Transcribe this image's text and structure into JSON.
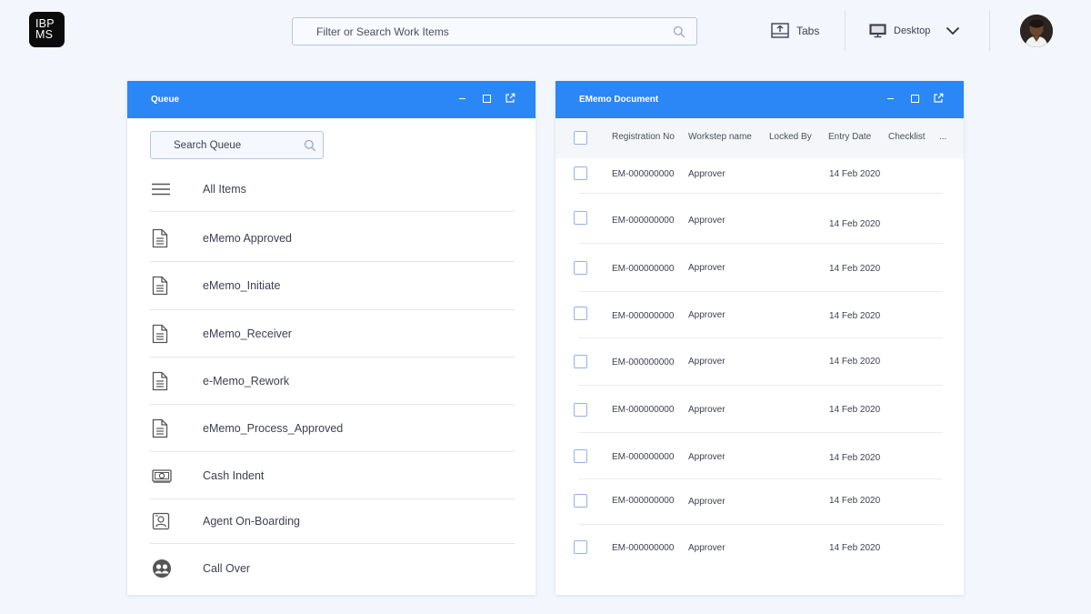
{
  "header": {
    "logo_line1": "IBP",
    "logo_line2": "MS",
    "search_placeholder": "Filter or Search Work Items",
    "tabs_label": "Tabs",
    "desktop_label": "Desktop"
  },
  "queue_panel": {
    "title": "Queue",
    "search_placeholder": "Search Queue",
    "items": [
      {
        "label": "All Items",
        "icon": "menu-icon"
      },
      {
        "label": "eMemo Approved",
        "icon": "document-icon"
      },
      {
        "label": "eMemo_Initiate",
        "icon": "document-icon"
      },
      {
        "label": "eMemo_Receiver",
        "icon": "document-icon"
      },
      {
        "label": "e-Memo_Rework",
        "icon": "document-icon"
      },
      {
        "label": "eMemo_Process_Approved",
        "icon": "document-icon"
      },
      {
        "label": "Cash Indent",
        "icon": "cash-icon"
      },
      {
        "label": "Agent On-Boarding",
        "icon": "id-card-icon"
      },
      {
        "label": "Call Over",
        "icon": "group-icon"
      }
    ]
  },
  "document_panel": {
    "title": "EMemo Document",
    "columns": [
      "Registration No",
      "Workstep name",
      "Locked By",
      "Entry Date",
      "Checklist",
      "..."
    ],
    "rows": [
      {
        "reg_no": "EM-000000000",
        "workstep": "Approver",
        "locked_by": "",
        "entry_date": "14 Feb 2020"
      },
      {
        "reg_no": "EM-000000000",
        "workstep": "Approver",
        "locked_by": "",
        "entry_date": "14 Feb 2020"
      },
      {
        "reg_no": "EM-000000000",
        "workstep": "Approver",
        "locked_by": "",
        "entry_date": "14 Feb 2020"
      },
      {
        "reg_no": "EM-000000000",
        "workstep": "Approver",
        "locked_by": "",
        "entry_date": "14 Feb 2020"
      },
      {
        "reg_no": "EM-000000000",
        "workstep": "Approver",
        "locked_by": "",
        "entry_date": "14 Feb 2020"
      },
      {
        "reg_no": "EM-000000000",
        "workstep": "Approver",
        "locked_by": "",
        "entry_date": "14 Feb 2020"
      },
      {
        "reg_no": "EM-000000000",
        "workstep": "Approver",
        "locked_by": "",
        "entry_date": "14 Feb 2020"
      },
      {
        "reg_no": "EM-000000000",
        "workstep": "Approver",
        "locked_by": "",
        "entry_date": "14 Feb 2020"
      },
      {
        "reg_no": "EM-000000000",
        "workstep": "Approver",
        "locked_by": "",
        "entry_date": "14 Feb 2020"
      }
    ]
  },
  "colors": {
    "accent": "#2b86f6",
    "background": "#f3f6fc",
    "checkbox_border": "#8fb3ea"
  }
}
